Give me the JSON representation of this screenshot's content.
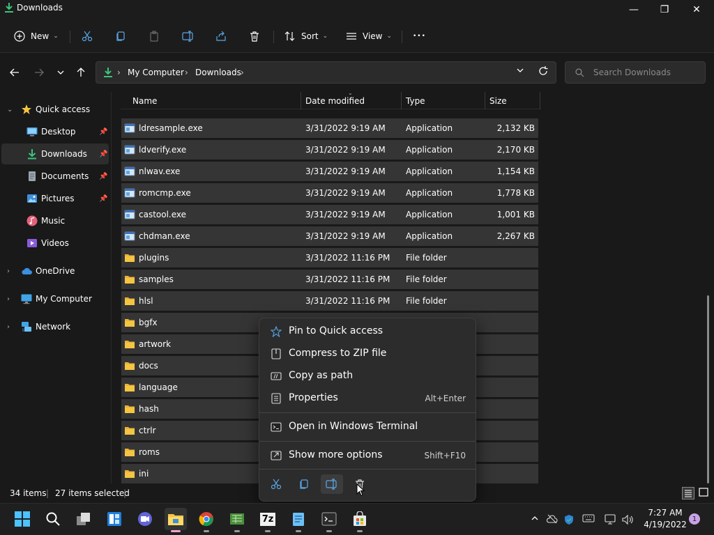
{
  "window": {
    "title": "Downloads",
    "minimize_glyph": "—",
    "maximize_glyph": "❐",
    "close_glyph": "✕"
  },
  "toolbar": {
    "new_label": "New",
    "sort_label": "Sort",
    "view_label": "View",
    "more_glyph": "•••"
  },
  "address": {
    "crumbs": [
      "My Computer",
      "Downloads"
    ],
    "search_placeholder": "Search Downloads"
  },
  "sidebar": {
    "items": [
      {
        "label": "Quick access",
        "icon": "star-icon",
        "pinned": false
      },
      {
        "label": "Desktop",
        "icon": "desktop-icon",
        "pinned": true
      },
      {
        "label": "Downloads",
        "icon": "download-icon",
        "pinned": true,
        "selected": true
      },
      {
        "label": "Documents",
        "icon": "document-icon",
        "pinned": true
      },
      {
        "label": "Pictures",
        "icon": "pictures-icon",
        "pinned": true
      },
      {
        "label": "Music",
        "icon": "music-icon",
        "pinned": false
      },
      {
        "label": "Videos",
        "icon": "videos-icon",
        "pinned": false
      },
      {
        "label": "OneDrive",
        "icon": "cloud-icon",
        "pinned": false
      },
      {
        "label": "My Computer",
        "icon": "computer-icon",
        "pinned": false
      },
      {
        "label": "Network",
        "icon": "network-icon",
        "pinned": false
      }
    ]
  },
  "columns": {
    "name": "Name",
    "date": "Date modified",
    "type": "Type",
    "size": "Size"
  },
  "files": [
    {
      "name": "ldresample.exe",
      "date": "3/31/2022 9:19 AM",
      "type": "Application",
      "size": "2,132 KB"
    },
    {
      "name": "ldverify.exe",
      "date": "3/31/2022 9:19 AM",
      "type": "Application",
      "size": "2,170 KB"
    },
    {
      "name": "nlwav.exe",
      "date": "3/31/2022 9:19 AM",
      "type": "Application",
      "size": "1,154 KB"
    },
    {
      "name": "romcmp.exe",
      "date": "3/31/2022 9:19 AM",
      "type": "Application",
      "size": "1,778 KB"
    },
    {
      "name": "castool.exe",
      "date": "3/31/2022 9:19 AM",
      "type": "Application",
      "size": "1,001 KB"
    },
    {
      "name": "chdman.exe",
      "date": "3/31/2022 9:19 AM",
      "type": "Application",
      "size": "2,267 KB"
    },
    {
      "name": "plugins",
      "date": "3/31/2022 11:16 PM",
      "type": "File folder",
      "size": ""
    },
    {
      "name": "samples",
      "date": "3/31/2022 11:16 PM",
      "type": "File folder",
      "size": ""
    },
    {
      "name": "hlsl",
      "date": "3/31/2022 11:16 PM",
      "type": "File folder",
      "size": ""
    },
    {
      "name": "bgfx",
      "date": "",
      "type": "",
      "size": ""
    },
    {
      "name": "artwork",
      "date": "",
      "type": "",
      "size": ""
    },
    {
      "name": "docs",
      "date": "",
      "type": "",
      "size": ""
    },
    {
      "name": "language",
      "date": "",
      "type": "",
      "size": ""
    },
    {
      "name": "hash",
      "date": "",
      "type": "",
      "size": ""
    },
    {
      "name": "ctrlr",
      "date": "",
      "type": "",
      "size": ""
    },
    {
      "name": "roms",
      "date": "",
      "type": "",
      "size": ""
    },
    {
      "name": "ini",
      "date": "",
      "type": "",
      "size": ""
    }
  ],
  "status": {
    "item_count": "34 items",
    "selected_count": "27 items selected"
  },
  "context_menu": {
    "pin": "Pin to Quick access",
    "zip": "Compress to ZIP file",
    "copy_path": "Copy as path",
    "properties": "Properties",
    "properties_key": "Alt+Enter",
    "terminal": "Open in Windows Terminal",
    "more_options": "Show more options",
    "more_options_key": "Shift+F10"
  },
  "taskbar": {
    "time": "7:27 AM",
    "date": "4/19/2022",
    "notification_count": "1",
    "zip_app_label": "7z"
  },
  "colors": {
    "accent_green": "#3cc47c",
    "folder_yellow": "#f5c542",
    "active_indicator": "#f8a3ce"
  }
}
